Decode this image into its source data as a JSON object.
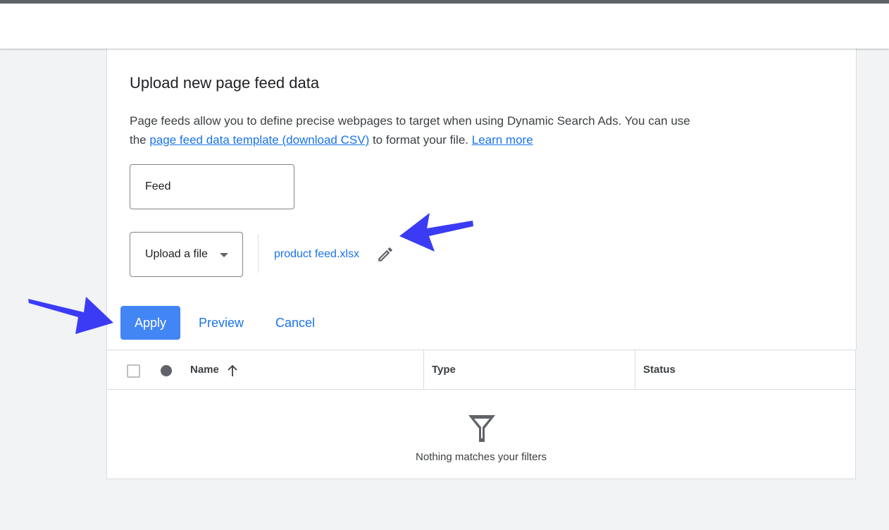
{
  "dialog": {
    "title": "Upload new page feed data",
    "description_part1": "Page feeds allow you to define precise webpages to target when using Dynamic Search Ads. You can use the ",
    "template_link": "page feed data template (download CSV)",
    "description_part2": " to format your file. ",
    "learn_more_link": "Learn more"
  },
  "form": {
    "feed_value": "Feed",
    "upload_select_value": "Upload a file",
    "file_name": "product feed.xlsx"
  },
  "actions": {
    "apply_label": "Apply",
    "preview_label": "Preview",
    "cancel_label": "Cancel"
  },
  "table": {
    "columns": [
      "Name",
      "Type",
      "Status"
    ],
    "empty_message": "Nothing matches your filters"
  },
  "icons": {
    "edit": "pencil-icon",
    "sort": "arrow-up-icon",
    "empty": "filter-icon",
    "dropdown": "caret-down-icon"
  },
  "colors": {
    "accent": "#1a73e8",
    "primary_button": "#4285f4",
    "annotation_arrow": "#3b3bf5",
    "background": "#f1f3f4"
  }
}
